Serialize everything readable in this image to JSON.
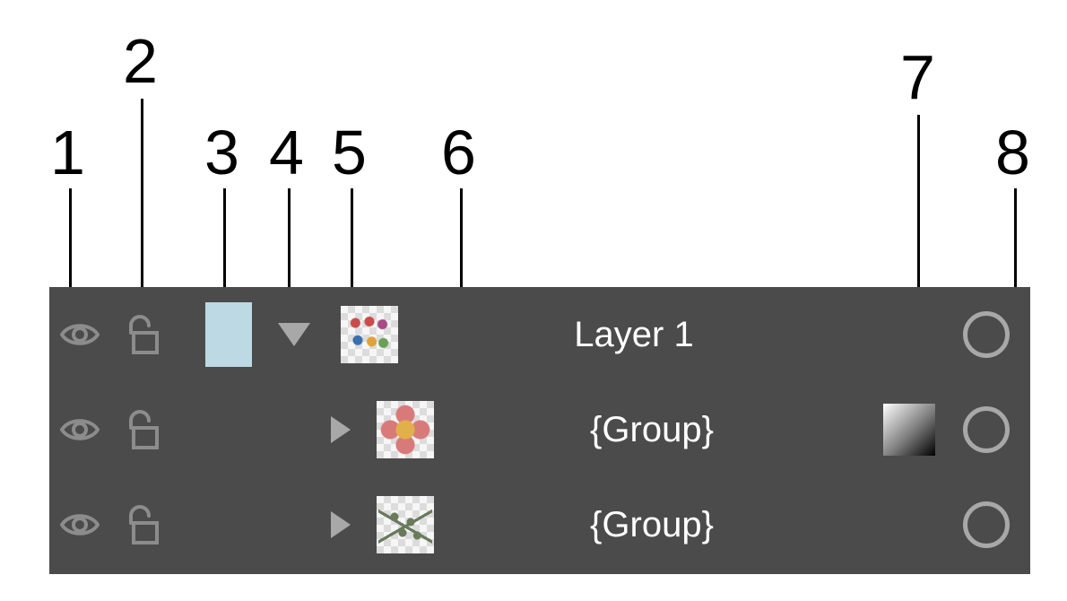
{
  "callouts": {
    "n1": "1",
    "n2": "2",
    "n3": "3",
    "n4": "4",
    "n5": "5",
    "n6": "6",
    "n7": "7",
    "n8": "8"
  },
  "panel": {
    "rows": [
      {
        "name": "Layer 1",
        "indent": 0,
        "expanded": true,
        "hasColorSwatch": true,
        "thumbKind": "flowers",
        "hasAppearance": false
      },
      {
        "name": "{Group}",
        "indent": 1,
        "expanded": false,
        "hasColorSwatch": false,
        "thumbKind": "flower",
        "hasAppearance": true
      },
      {
        "name": "{Group}",
        "indent": 1,
        "expanded": false,
        "hasColorSwatch": false,
        "thumbKind": "leaves",
        "hasAppearance": false
      }
    ]
  }
}
